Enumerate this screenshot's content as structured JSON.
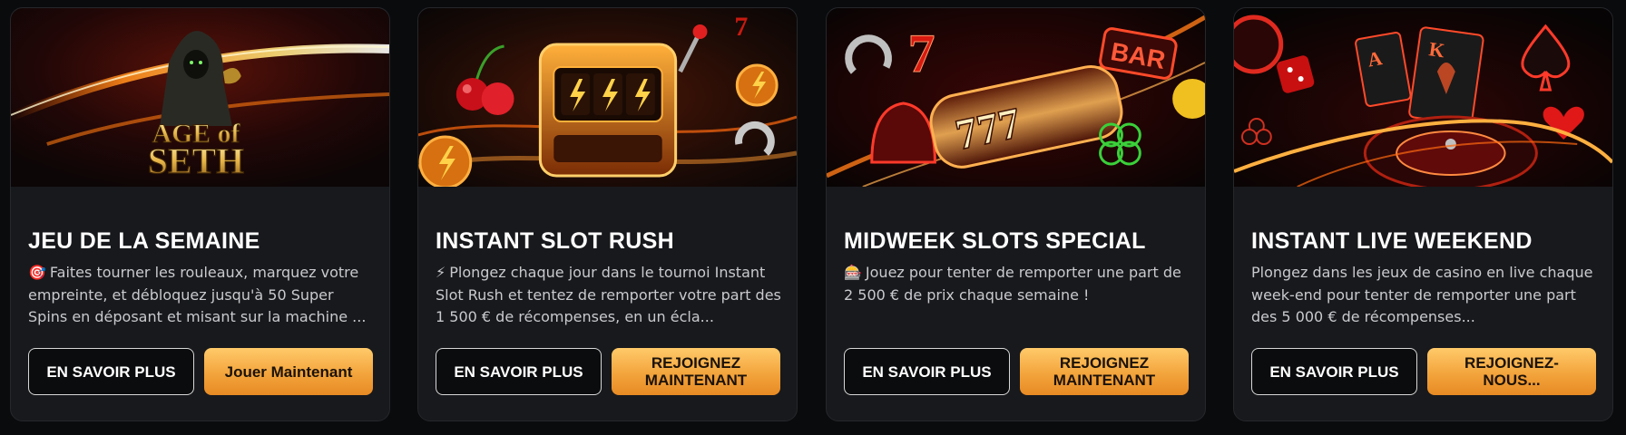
{
  "colors": {
    "card_bg": "#18191c",
    "page_bg": "#0a0b0d",
    "gold_button": "#f3a43c",
    "outline_button_border": "#d7d7d7"
  },
  "cards": [
    {
      "banner_icon": "age-of-seth-banner",
      "banner_text": {
        "line1": "AGE of",
        "line2": "SETH"
      },
      "title": "JEU DE LA SEMAINE",
      "emoji": "🎯",
      "description": "Faites tourner les rouleaux, marquez votre empreinte, et débloquez jusqu'à 50 Super Spins en déposant et misant sur la machine ...",
      "primary_label": "EN SAVOIR PLUS",
      "secondary_label": "Jouer Maintenant"
    },
    {
      "banner_icon": "slot-machine-banner",
      "title": "INSTANT SLOT RUSH",
      "emoji": "⚡",
      "description": "Plongez chaque jour dans le tournoi Instant Slot Rush et tentez de remporter votre part des 1 500 € de récompenses, en un écla...",
      "primary_label": "EN SAVOIR PLUS",
      "secondary_label": "REJOIGNEZ MAINTENANT"
    },
    {
      "banner_icon": "lucky-777-banner",
      "banner_text": {
        "line1": "BAR",
        "line2": "777"
      },
      "title": "MIDWEEK SLOTS SPECIAL",
      "emoji": "🎰",
      "description": "Jouez pour tenter de remporter une part de 2 500 € de prix chaque semaine !",
      "primary_label": "EN SAVOIR PLUS",
      "secondary_label": "REJOIGNEZ MAINTENANT"
    },
    {
      "banner_icon": "live-casino-banner",
      "title": "INSTANT LIVE WEEKEND",
      "emoji": "",
      "description": "Plongez dans les jeux de casino en live chaque week-end pour tenter de remporter une part des 5 000 € de récompenses...",
      "primary_label": "EN SAVOIR PLUS",
      "secondary_label": "REJOIGNEZ-NOUS..."
    }
  ]
}
